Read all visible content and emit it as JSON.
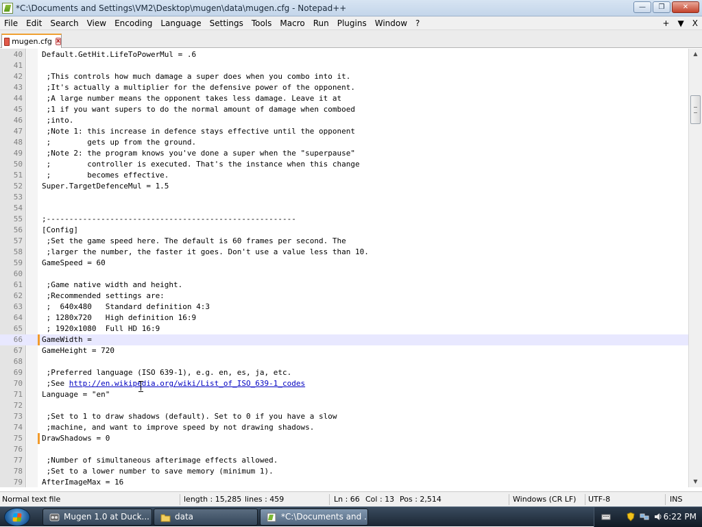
{
  "window": {
    "title": "*C:\\Documents and Settings\\VM2\\Desktop\\mugen\\data\\mugen.cfg - Notepad++",
    "minimize": "—",
    "maximize": "❐",
    "close": "✕"
  },
  "menu": {
    "items": [
      "File",
      "Edit",
      "Search",
      "View",
      "Encoding",
      "Language",
      "Settings",
      "Tools",
      "Macro",
      "Run",
      "Plugins",
      "Window",
      "?"
    ],
    "right": [
      "+",
      "▼",
      "X"
    ]
  },
  "tab": {
    "label": "mugen.cfg",
    "close": "x"
  },
  "editor": {
    "current_line": 66,
    "lines": [
      {
        "n": "40",
        "text": "Default.GetHit.LifeToPowerMul = .6"
      },
      {
        "n": "41",
        "text": ""
      },
      {
        "n": "42",
        "text": " ;This controls how much damage a super does when you combo into it."
      },
      {
        "n": "43",
        "text": " ;It's actually a multiplier for the defensive power of the opponent."
      },
      {
        "n": "44",
        "text": " ;A large number means the opponent takes less damage. Leave it at"
      },
      {
        "n": "45",
        "text": " ;1 if you want supers to do the normal amount of damage when comboed"
      },
      {
        "n": "46",
        "text": " ;into."
      },
      {
        "n": "47",
        "text": " ;Note 1: this increase in defence stays effective until the opponent"
      },
      {
        "n": "48",
        "text": " ;        gets up from the ground."
      },
      {
        "n": "49",
        "text": " ;Note 2: the program knows you've done a super when the \"superpause\""
      },
      {
        "n": "50",
        "text": " ;        controller is executed. That's the instance when this change"
      },
      {
        "n": "51",
        "text": " ;        becomes effective."
      },
      {
        "n": "52",
        "text": "Super.TargetDefenceMul = 1.5"
      },
      {
        "n": "53",
        "text": ""
      },
      {
        "n": "54",
        "text": ""
      },
      {
        "n": "55",
        "text": ";-------------------------------------------------------"
      },
      {
        "n": "56",
        "text": "[Config]"
      },
      {
        "n": "57",
        "text": " ;Set the game speed here. The default is 60 frames per second. The"
      },
      {
        "n": "58",
        "text": " ;larger the number, the faster it goes. Don't use a value less than 10."
      },
      {
        "n": "59",
        "text": "GameSpeed = 60"
      },
      {
        "n": "60",
        "text": ""
      },
      {
        "n": "61",
        "text": " ;Game native width and height."
      },
      {
        "n": "62",
        "text": " ;Recommended settings are:"
      },
      {
        "n": "63",
        "text": " ;  640x480   Standard definition 4:3"
      },
      {
        "n": "64",
        "text": " ; 1280x720   High definition 16:9"
      },
      {
        "n": "65",
        "text": " ; 1920x1080  Full HD 16:9"
      },
      {
        "n": "66",
        "text": "GameWidth ="
      },
      {
        "n": "67",
        "text": "GameHeight = 720"
      },
      {
        "n": "68",
        "text": ""
      },
      {
        "n": "69",
        "text": " ;Preferred language (ISO 639-1), e.g. en, es, ja, etc."
      },
      {
        "n": "70",
        "text": " ;See ",
        "link": "http://en.wikipedia.org/wiki/List_of_ISO_639-1_codes"
      },
      {
        "n": "71",
        "text": "Language = \"en\""
      },
      {
        "n": "72",
        "text": ""
      },
      {
        "n": "73",
        "text": " ;Set to 1 to draw shadows (default). Set to 0 if you have a slow"
      },
      {
        "n": "74",
        "text": " ;machine, and want to improve speed by not drawing shadows."
      },
      {
        "n": "75",
        "text": "DrawShadows = 0"
      },
      {
        "n": "76",
        "text": ""
      },
      {
        "n": "77",
        "text": " ;Number of simultaneous afterimage effects allowed."
      },
      {
        "n": "78",
        "text": " ;Set to a lower number to save memory (minimum 1)."
      },
      {
        "n": "79",
        "text": "AfterImageMax = 16"
      }
    ],
    "modified_lines": [
      66,
      75
    ]
  },
  "scrollbar": {
    "up": "▲",
    "down": "▼"
  },
  "status": {
    "file_type": "Normal text file",
    "length": "length : 15,285",
    "lines": "lines : 459",
    "ln": "Ln : 66",
    "col": "Col : 13",
    "pos": "Pos : 2,514",
    "eol": "Windows (CR LF)",
    "encoding": "UTF-8",
    "mode": "INS"
  },
  "taskbar": {
    "tasks": [
      {
        "label": "Mugen 1.0 at Duck..."
      },
      {
        "label": "data"
      },
      {
        "label": "*C:\\Documents and ..."
      }
    ],
    "clock": "6:22 PM"
  },
  "colors": {
    "modified_marker": "#f29b2b",
    "current_line_bg": "#e8e8ff",
    "link": "#0000c0"
  }
}
